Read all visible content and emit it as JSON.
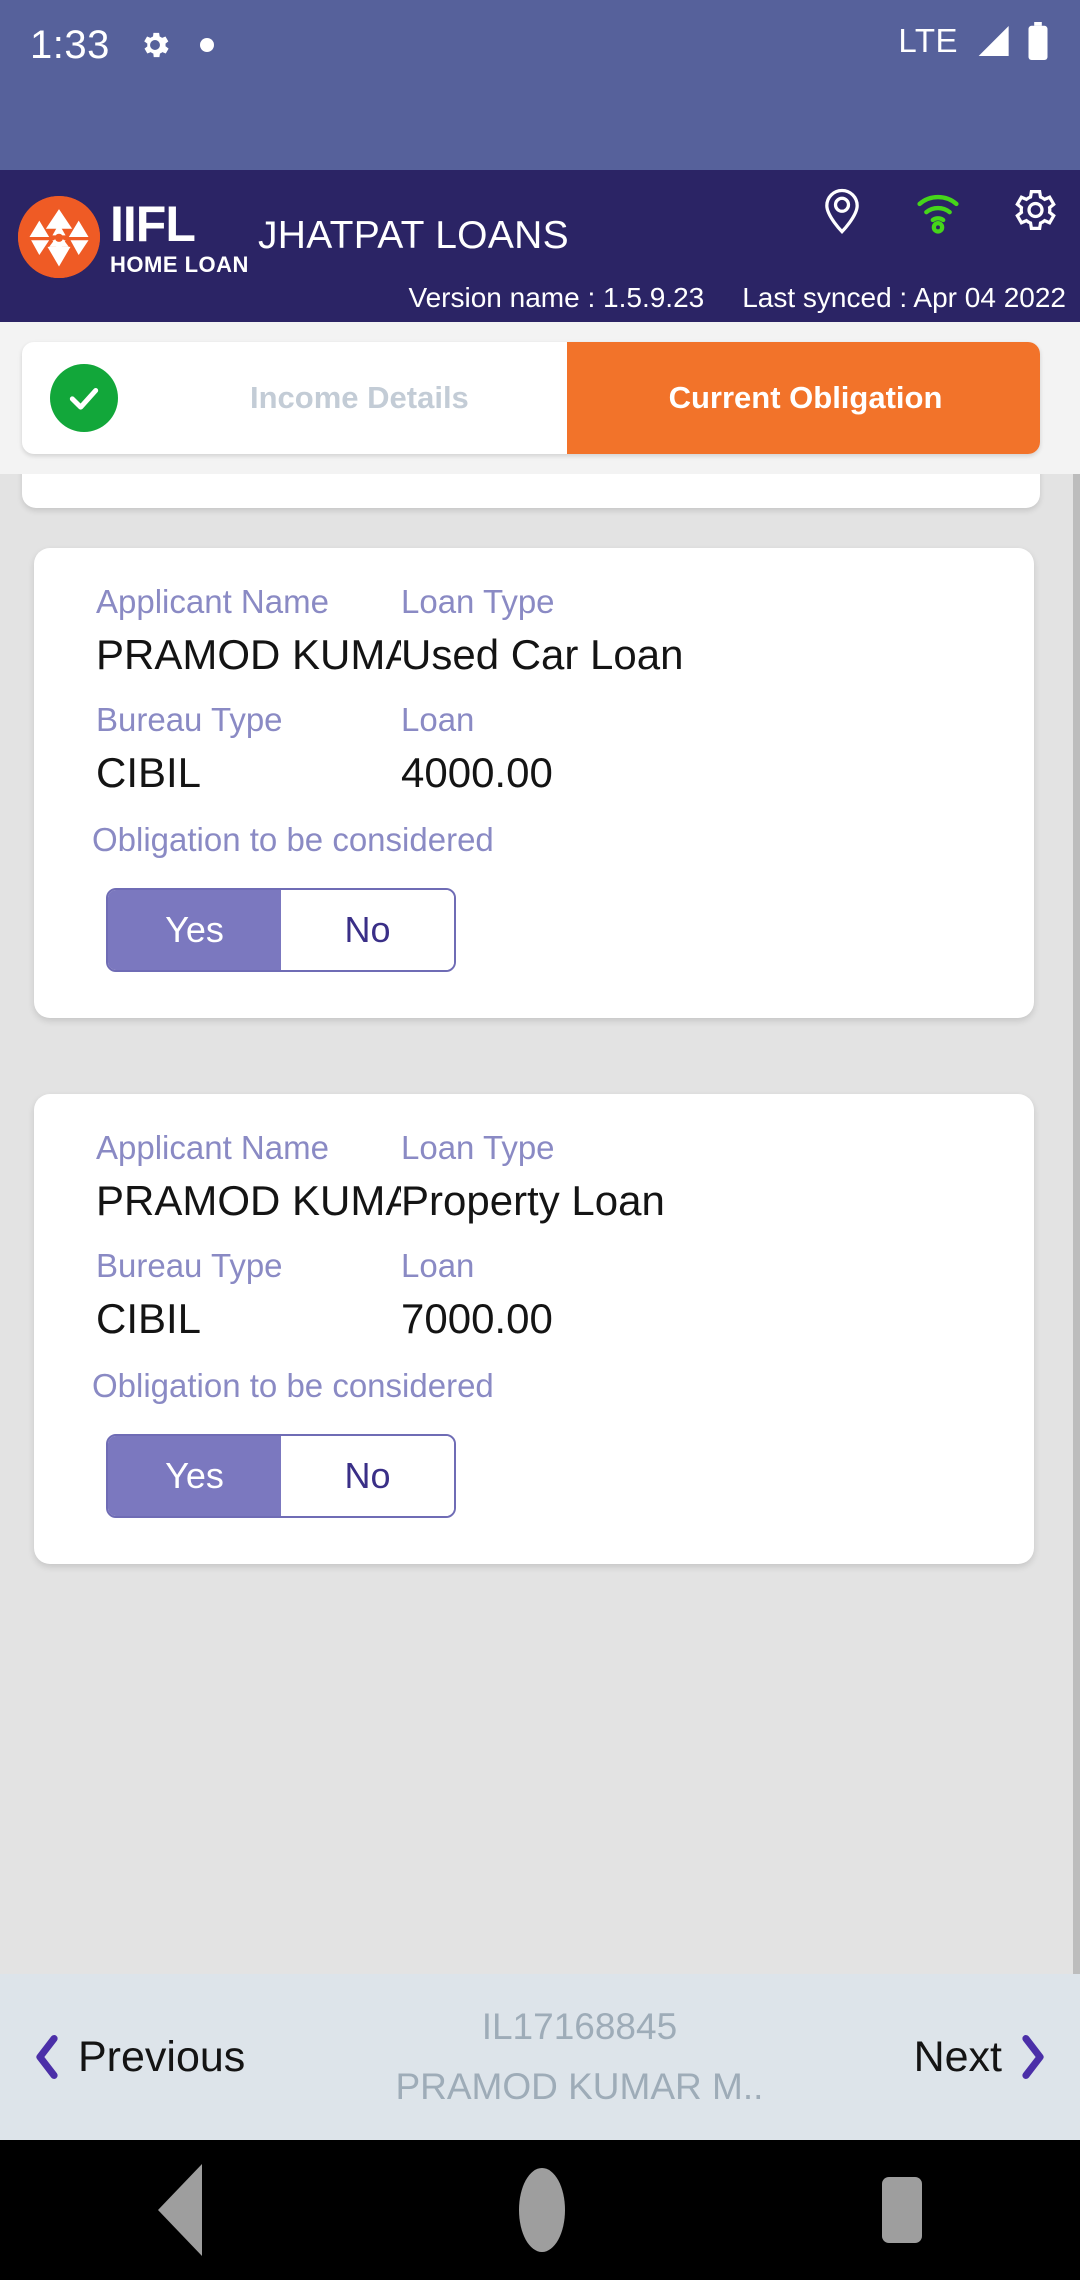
{
  "status_bar": {
    "time": "1:33",
    "gear_icon": "gear-icon",
    "dot_icon": "notification-dot-icon",
    "network_label": "LTE",
    "signal_icon": "signal-bars-icon",
    "battery_icon": "battery-icon",
    "background_color": "#56619b"
  },
  "header": {
    "logo_name": "IIFL",
    "logo_subtitle": "HOME LOAN",
    "logo_mark_icon": "iifl-sri-yantra-logo-icon",
    "app_title": "JHATPAT LOANS",
    "version_label": "Version name : 1.5.9.23",
    "last_synced_label": "Last synced : Apr 04 2022",
    "background_color": "#2b2465",
    "icons": [
      {
        "name": "location-pin-icon",
        "color": "#ffffff"
      },
      {
        "name": "wifi-icon",
        "color": "#45d61a"
      },
      {
        "name": "settings-gear-icon",
        "color": "#ffffff"
      }
    ]
  },
  "stepper": {
    "completed_step": {
      "label": "Income Details",
      "check_icon": "check-icon",
      "check_color": "#12a73a",
      "text_color": "#c3ccd6"
    },
    "active_step": {
      "label": "Current Obligation",
      "background_color": "#f2732a",
      "text_color": "#ffffff"
    }
  },
  "labels": {
    "applicant_name": "Applicant Name",
    "loan_type": "Loan Type",
    "bureau_type": "Bureau Type",
    "loan": "Loan",
    "obligation": "Obligation to be considered",
    "toggle_yes": "Yes",
    "toggle_no": "No"
  },
  "obligation_cards": [
    {
      "applicant_name": "PRAMOD KUMA…",
      "loan_type": "Used Car Loan",
      "bureau_type": "CIBIL",
      "loan_amount": "4000.00",
      "obligation_selected": "Yes"
    },
    {
      "applicant_name": "PRAMOD KUMA…",
      "loan_type": "Property Loan",
      "bureau_type": "CIBIL",
      "loan_amount": "7000.00",
      "obligation_selected": "Yes"
    }
  ],
  "bottom_nav": {
    "previous_label": "Previous",
    "next_label": "Next",
    "previous_icon": "chevron-left-icon",
    "next_icon": "chevron-right-icon",
    "application_id": "IL17168845",
    "applicant_name": "PRAMOD KUMAR M..",
    "background_color": "#dde4ea"
  },
  "android_nav": {
    "back_icon": "back-triangle-icon",
    "home_icon": "home-circle-icon",
    "recents_icon": "recents-square-icon"
  },
  "colors": {
    "accent_orange": "#f2732a",
    "brand_purple": "#2b2465",
    "toggle_purple": "#7b78bf",
    "label_purple": "#8a8ac4",
    "page_background": "#e3e3e3"
  }
}
